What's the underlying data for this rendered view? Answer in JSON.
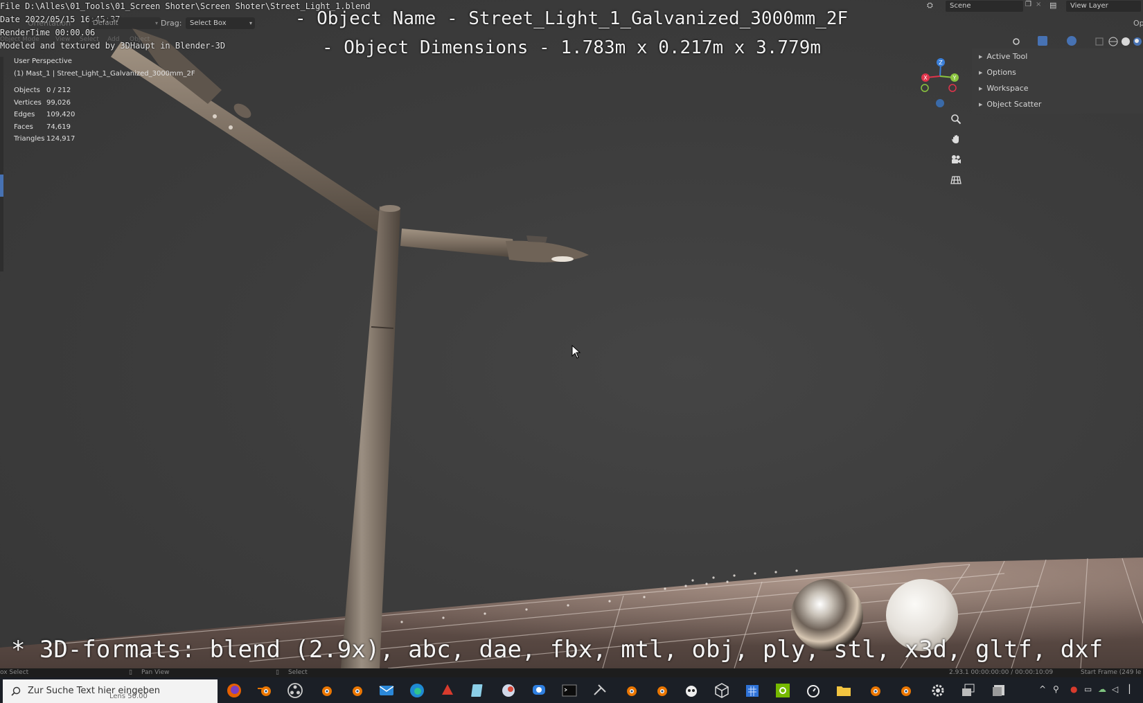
{
  "render_stamp": {
    "file": "File D:\\Alles\\01_Tools\\01_Screen Shoter\\Screen Shoter\\Street_Light_1.blend",
    "date": "Date 2022/05/15 16:45:37",
    "render_time": "RenderTime 00:00.06",
    "credit": "Modeled and textured by 3DHaupt in Blender-3D"
  },
  "overlay": {
    "object_name": "- Object Name - Street_Light_1_Galvanized_3000mm_2F",
    "object_dimensions": "- Object Dimensions -  1.783m x 0.217m x 3.779m",
    "formats": "* 3D-formats: blend (2.9x), abc, dae, fbx, mtl, obj, ply, stl, x3d, gltf, dxf"
  },
  "header": {
    "orientation_label": "Orientation",
    "orientation_value": "Default",
    "drag_label": "Drag:",
    "drag_value": "Select Box",
    "menu_object_mode": "Object Mode",
    "menu_view": "View",
    "menu_select": "Select",
    "menu_add": "Add",
    "menu_object": "Object",
    "options_short": "Op",
    "scene_label": "Scene",
    "view_layer_label": "View Layer"
  },
  "viewport_info": {
    "perspective": "User Perspective",
    "active_object": "(1) Mast_1 | Street_Light_1_Galvanized_3000mm_2F",
    "stats": [
      {
        "key": "Objects",
        "value": "0 / 212"
      },
      {
        "key": "Vertices",
        "value": "99,026"
      },
      {
        "key": "Edges",
        "value": "109,420"
      },
      {
        "key": "Faces",
        "value": "74,619"
      },
      {
        "key": "Triangles",
        "value": "124,917"
      }
    ]
  },
  "side_panel": {
    "items": [
      {
        "label": "Active Tool"
      },
      {
        "label": "Options"
      },
      {
        "label": "Workspace"
      },
      {
        "label": "Object Scatter"
      }
    ]
  },
  "gizmo": {
    "x": "X",
    "y": "Y",
    "z": "Z"
  },
  "status_bar": {
    "left_select": "ox Select",
    "pan_view": "Pan View",
    "select": "Select",
    "version_time": "2.93.1  00:00:00:00 / 00:00:10:09",
    "start_frame": "Start Frame (249 le"
  },
  "taskbar": {
    "search_placeholder": "Zur Suche Text hier eingeben",
    "ghost_text": "Lens 50.00"
  },
  "colors": {
    "axis_x": "#e0344b",
    "axis_y": "#8bc53f",
    "axis_z": "#3a7fd9",
    "blender_orange": "#ea7600",
    "active_blue": "#4772b3"
  }
}
